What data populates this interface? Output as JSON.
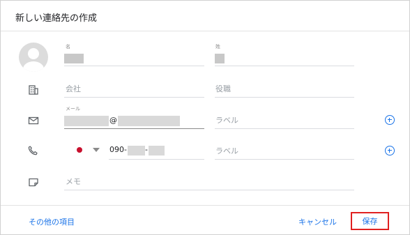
{
  "dialog": {
    "title": "新しい連絡先の作成"
  },
  "name": {
    "first_label": "名",
    "last_label": "姓"
  },
  "company": {
    "company_placeholder": "会社",
    "title_placeholder": "役職"
  },
  "email": {
    "label": "メール",
    "at": "@",
    "type_placeholder": "ラベル"
  },
  "phone": {
    "prefix": "090-",
    "separator": "-",
    "type_placeholder": "ラベル"
  },
  "notes": {
    "placeholder": "メモ"
  },
  "footer": {
    "more_fields": "その他の項目",
    "cancel": "キャンセル",
    "save": "保存"
  },
  "colors": {
    "accent": "#1a73e8",
    "highlight": "#e02020",
    "flag": "#c8102e"
  }
}
